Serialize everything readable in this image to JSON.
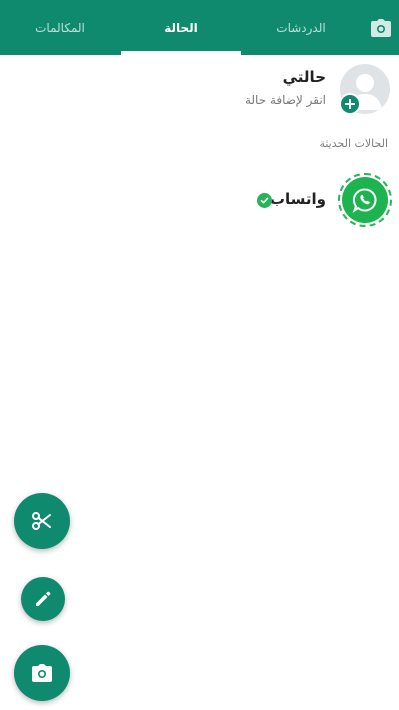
{
  "tabs": {
    "calls": "المكالمات",
    "status": "الحالة",
    "chats": "الدردشات",
    "active": "status"
  },
  "my_status": {
    "title": "حالتي",
    "subtitle": "انقر لإضافة حالة"
  },
  "recent": {
    "section_label": "الحالات الحديثة",
    "items": [
      {
        "name": "واتساب",
        "verified": true,
        "icon": "whatsapp-logo-icon"
      }
    ]
  },
  "fabs": [
    {
      "icon": "scissors-icon"
    },
    {
      "icon": "pencil-icon"
    },
    {
      "icon": "camera-icon"
    }
  ],
  "colors": {
    "header": "#0f8a6f",
    "accent_green": "#1db34f",
    "ring": "#25b55a"
  }
}
